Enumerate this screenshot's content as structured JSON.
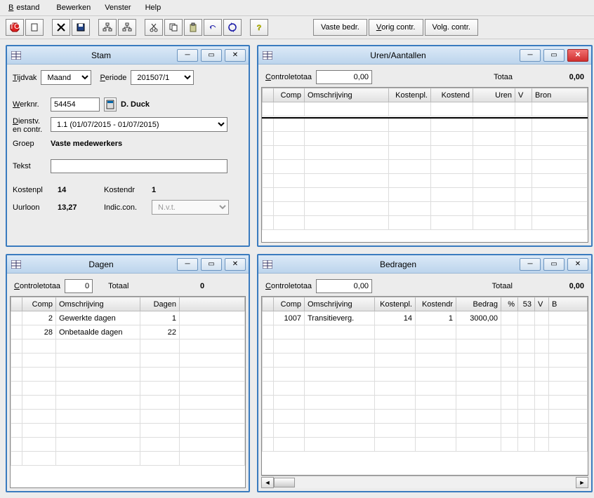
{
  "menu": {
    "bestand": "Bestand",
    "bewerken": "Bewerken",
    "venster": "Venster",
    "help": "Help"
  },
  "toolbar": {
    "vaste_bedr": "Vaste bedr.",
    "vorig_contr": "Vorig contr.",
    "volg_contr": "Volg. contr."
  },
  "stam": {
    "title": "Stam",
    "tijdvak_label": "Tijdvak",
    "tijdvak_value": "Maand",
    "periode_label": "Periode",
    "periode_value": "201507/1",
    "werknr_label": "Werknr.",
    "werknr_value": "54454",
    "werknr_name": "D. Duck",
    "dienstv_label": "Dienstv. en contr.",
    "dienstv_value": "1.1 (01/07/2015 - 01/07/2015)",
    "groep_label": "Groep",
    "groep_value": "Vaste medewerkers",
    "tekst_label": "Tekst",
    "tekst_value": "",
    "kostenpl_label": "Kostenpl",
    "kostenpl_value": "14",
    "kostendr_label": "Kostendr",
    "kostendr_value": "1",
    "uurloon_label": "Uurloon",
    "uurloon_value": "13,27",
    "indic_label": "Indic.con.",
    "indic_value": "N.v.t."
  },
  "uren": {
    "title": "Uren/Aantallen",
    "controle_label": "Controletotaa",
    "controle_value": "0,00",
    "totaal_label": "Totaa",
    "totaal_value": "0,00",
    "headers": {
      "comp": "Comp",
      "omschr": "Omschrijving",
      "kostenpl": "Kostenpl.",
      "kostend": "Kostend",
      "uren": "Uren",
      "v": "V",
      "bron": "Bron"
    }
  },
  "dagen": {
    "title": "Dagen",
    "controle_label": "Controletotaa",
    "controle_value": "0",
    "totaal_label": "Totaal",
    "totaal_value": "0",
    "headers": {
      "comp": "Comp",
      "omschr": "Omschrijving",
      "dagen": "Dagen"
    },
    "rows": [
      {
        "comp": "2",
        "omschr": "Gewerkte dagen",
        "dagen": "1"
      },
      {
        "comp": "28",
        "omschr": "Onbetaalde dagen",
        "dagen": "22"
      }
    ]
  },
  "bedragen": {
    "title": "Bedragen",
    "controle_label": "Controletotaa",
    "controle_value": "0,00",
    "totaal_label": "Totaal",
    "totaal_value": "0,00",
    "headers": {
      "comp": "Comp",
      "omschr": "Omschrijving",
      "kostenpl": "Kostenpl.",
      "kostendr": "Kostendr",
      "bedrag": "Bedrag",
      "pct": "%",
      "c53": "53",
      "v": "V",
      "b": "B"
    },
    "rows": [
      {
        "comp": "1007",
        "omschr": "Transitieverg.",
        "kostenpl": "14",
        "kostendr": "1",
        "bedrag": "3000,00",
        "pct": "",
        "c53": "",
        "v": "",
        "b": ""
      }
    ]
  }
}
